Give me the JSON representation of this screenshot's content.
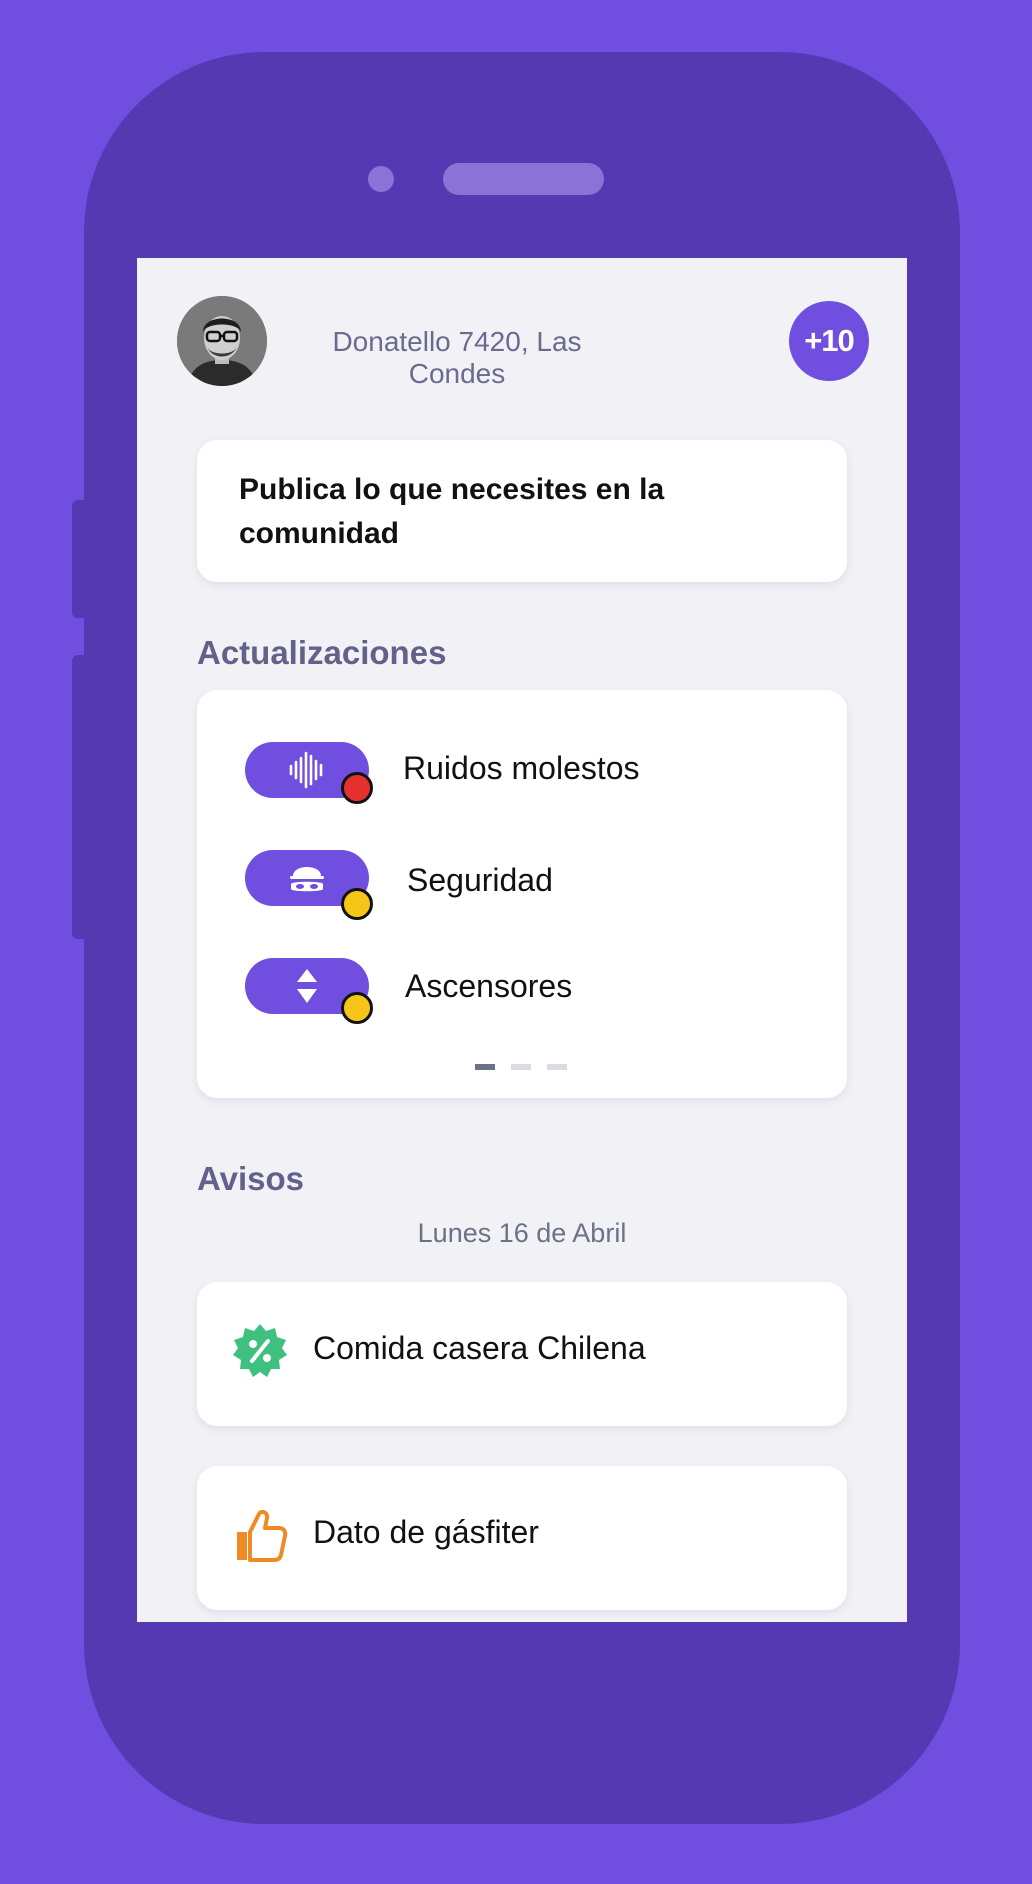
{
  "header": {
    "address": "Donatello 7420, Las Condes",
    "badge": "+10"
  },
  "post_prompt": "Publica lo que necesites en la comunidad",
  "updates": {
    "title": "Actualizaciones",
    "items": [
      {
        "label": "Ruidos molestos",
        "icon": "sound-wave-icon",
        "status_color": "#e53030"
      },
      {
        "label": "Seguridad",
        "icon": "burglar-icon",
        "status_color": "#f5c518"
      },
      {
        "label": "Ascensores",
        "icon": "elevator-arrows-icon",
        "status_color": "#f5c518"
      }
    ],
    "pager": {
      "pages": 3,
      "current": 1
    }
  },
  "notices": {
    "title": "Avisos",
    "date": "Lunes 16 de Abril",
    "items": [
      {
        "label": "Comida casera Chilena",
        "icon": "discount-badge-icon",
        "icon_color": "#3fc07f"
      },
      {
        "label": "Dato de gásfiter",
        "icon": "thumbs-up-icon",
        "icon_color": "#f08a24"
      }
    ]
  },
  "colors": {
    "accent": "#6f4ee0",
    "phone_body": "#5539b3",
    "screen_bg": "#f1f1f6"
  }
}
